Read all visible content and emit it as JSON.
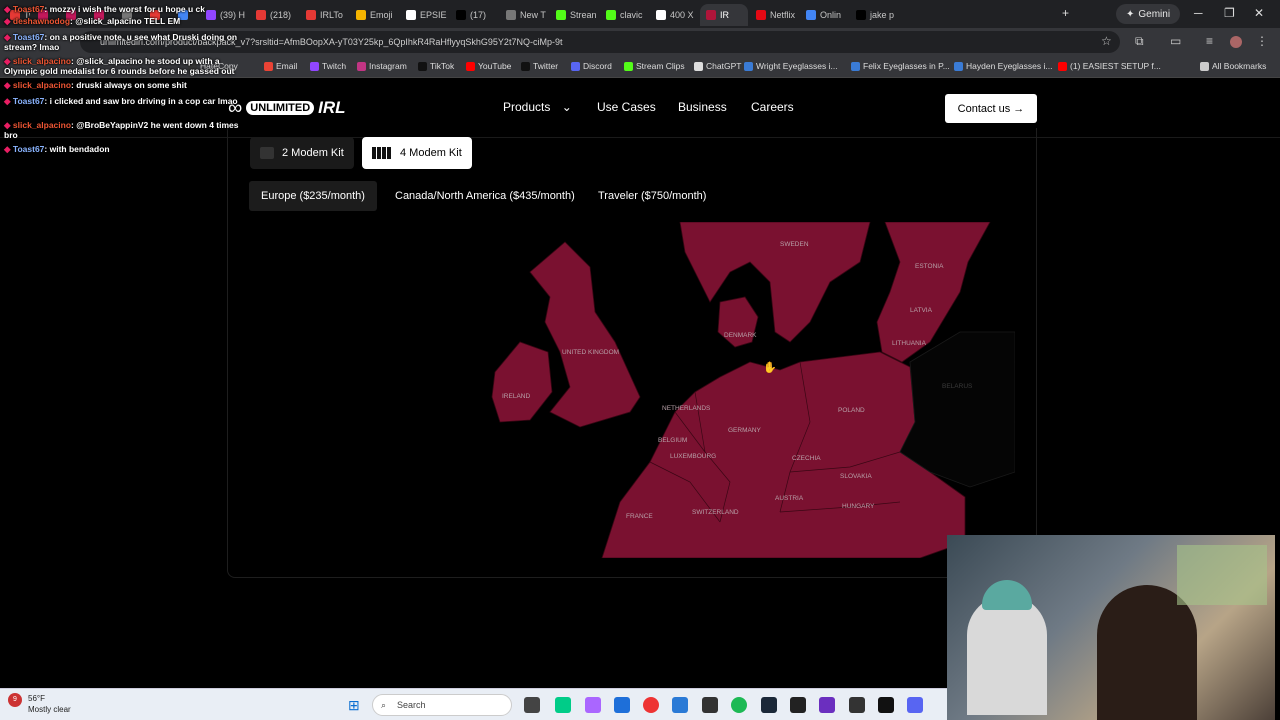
{
  "browser": {
    "tabs": [
      {
        "label": "Tw",
        "color": "#e53935"
      },
      {
        "label": "",
        "color": "#c2185b"
      },
      {
        "label": "",
        "color": "#c2185b"
      },
      {
        "label": "",
        "color": "#c2185b"
      },
      {
        "label": "",
        "color": "#777"
      },
      {
        "label": "",
        "color": "#e53935"
      },
      {
        "label": "",
        "color": "#4285f4"
      },
      {
        "label": "(39) H",
        "color": "#9146ff"
      },
      {
        "label": "(218)",
        "color": "#e53935"
      },
      {
        "label": "IRLTo",
        "color": "#e53935"
      },
      {
        "label": "Emoji",
        "color": "#f4b400"
      },
      {
        "label": "EPSIE",
        "color": "#fff"
      },
      {
        "label": "(17)",
        "color": "#000"
      },
      {
        "label": "New T",
        "color": "#777"
      },
      {
        "label": "Strean",
        "color": "#53fc18"
      },
      {
        "label": "clavic",
        "color": "#53fc18"
      },
      {
        "label": "400 X",
        "color": "#fff"
      },
      {
        "label": "IR",
        "color": "#b0153a"
      },
      {
        "label": "Netflix",
        "color": "#e50914"
      },
      {
        "label": "Onlin",
        "color": "#4285f4"
      },
      {
        "label": "jake p",
        "color": "#000"
      }
    ],
    "gemini_label": "Gemini",
    "url": "unlimitedirl.com/product/backpack_v7?srsltid=AfmBOopXA-yT03Y25kp_6QpIhkR4RaHflyyqSkhG95Y2t7NQ-ciMp-9t",
    "bookmarks": [
      {
        "label": "HateCopy",
        "color": "#333"
      },
      {
        "label": "Email",
        "color": "#ea4335"
      },
      {
        "label": "Twitch",
        "color": "#9146ff"
      },
      {
        "label": "Instagram",
        "color": "#c13584"
      },
      {
        "label": "TikTok",
        "color": "#111"
      },
      {
        "label": "YouTube",
        "color": "#ff0000"
      },
      {
        "label": "Twitter",
        "color": "#111"
      },
      {
        "label": "Discord",
        "color": "#5865f2"
      },
      {
        "label": "Stream Clips",
        "color": "#53fc18"
      },
      {
        "label": "ChatGPT",
        "color": "#ddd"
      },
      {
        "label": "Wright Eyeglasses i...",
        "color": "#3a7bd5"
      },
      {
        "label": "Felix Eyeglasses in P...",
        "color": "#3a7bd5"
      },
      {
        "label": "Hayden Eyeglasses i...",
        "color": "#3a7bd5"
      },
      {
        "label": "(1) EASIEST SETUP f...",
        "color": "#ff0000"
      },
      {
        "label": "All Bookmarks",
        "color": "#ccc"
      }
    ]
  },
  "site": {
    "logo_word1": "UNLIMITED",
    "logo_word2": "IRL",
    "nav": [
      "Products",
      "Use Cases",
      "Business",
      "Careers"
    ],
    "contact_label": "Contact us →",
    "kits": [
      {
        "label": "2 Modem Kit",
        "selected": false
      },
      {
        "label": "4 Modem Kit",
        "selected": true
      }
    ],
    "regions": [
      {
        "label": "Europe ($235/month)",
        "selected": true
      },
      {
        "label": "Canada/North America ($435/month)",
        "selected": false
      },
      {
        "label": "Traveler ($750/month)",
        "selected": false
      }
    ],
    "map": {
      "fill_color": "#7a1130",
      "country_labels": [
        "SWEDEN",
        "ESTONIA",
        "LATVIA",
        "LITHUANIA",
        "DENMARK",
        "UNITED KINGDOM",
        "IRELAND",
        "NETHERLANDS",
        "BELGIUM",
        "LUXEMBOURG",
        "GERMANY",
        "POLAND",
        "CZECHIA",
        "SLOVAKIA",
        "AUSTRIA",
        "HUNGARY",
        "SWITZERLAND",
        "FRANCE",
        "BELARUS"
      ]
    }
  },
  "chat": [
    {
      "user": "Toast67",
      "text": "mozzy i wish the worst for u hope u ck",
      "red": true
    },
    {
      "user": "deshawnodog",
      "text": "@slick_alpacino TELL EM",
      "red": true
    },
    {
      "user": "Toast67",
      "text": "on a positive note, u see what Druski doing on stream? lmao",
      "red": false
    },
    {
      "user": "slick_alpacino",
      "text": "@slick_alpacino he stood up with a Olympic gold medalist for 6 rounds before he gassed out",
      "red": true
    },
    {
      "user": "slick_alpacino",
      "text": "druski always on some shit",
      "red": true
    },
    {
      "user": "Toast67",
      "text": "i clicked and saw bro driving in a cop car lmao",
      "red": false
    },
    {
      "user": "slick_alpacino",
      "text": "@BroBeYappinV2 he went down 4 times bro",
      "red": true
    },
    {
      "user": "Toast67",
      "text": "with bendadon",
      "red": false
    }
  ],
  "taskbar": {
    "weather_temp": "56°F",
    "weather_desc": "Mostly clear",
    "search_placeholder": "Search",
    "notification_count": "9"
  }
}
